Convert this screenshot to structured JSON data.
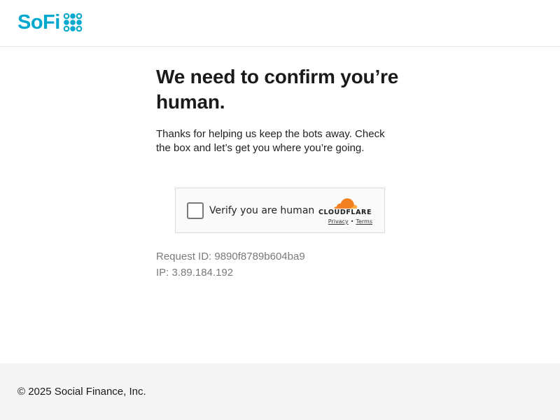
{
  "header": {
    "logo_text": "SoFi",
    "logo_icon": "sofi-dots-icon",
    "brand_color": "#00a7ce"
  },
  "main": {
    "title": "We need to confirm you’re human.",
    "subtitle": "Thanks for helping us keep the bots away. Check the box and let’s get you where you’re going."
  },
  "turnstile": {
    "checkbox_checked": false,
    "label": "Verify you are human",
    "brand": "CLOUDFLARE",
    "brand_icon": "cloudflare-cloud-icon",
    "brand_color": "#f38020",
    "privacy_link": "Privacy",
    "separator": "•",
    "terms_link": "Terms"
  },
  "meta": {
    "request_id": "Request ID: 9890f8789b604ba9",
    "ip": "IP: 3.89.184.192"
  },
  "footer": {
    "copyright": "© 2025 Social Finance, Inc."
  }
}
